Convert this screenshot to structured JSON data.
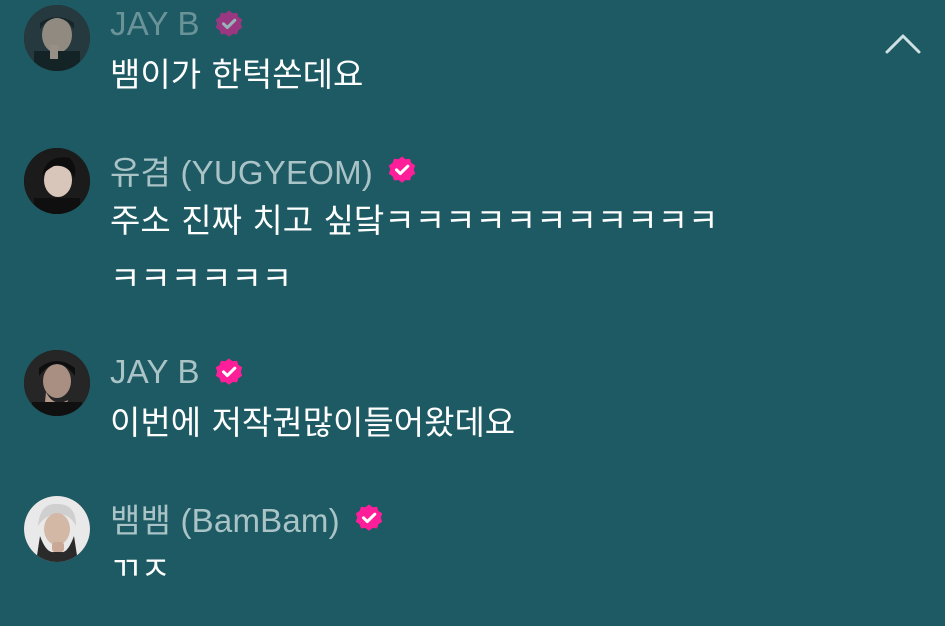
{
  "messages": [
    {
      "author": "JAY B",
      "verified": true,
      "lines": [
        "뱀이가 한턱쏜데요"
      ]
    },
    {
      "author": "유겸 (YUGYEOM)",
      "verified": true,
      "lines": [
        "주소 진짜 치고 싶닼ㅋㅋㅋㅋㅋㅋㅋㅋㅋㅋㅋ",
        "ㅋㅋㅋㅋㅋㅋ"
      ]
    },
    {
      "author": "JAY B",
      "verified": true,
      "lines": [
        "이번에 저작권많이들어왔데요"
      ]
    },
    {
      "author": "뱀뱀 (BamBam)",
      "verified": true,
      "lines": [
        "ㄲㅈ"
      ]
    }
  ],
  "colors": {
    "background": "#1d5a63",
    "name_text": "#a9c3c6",
    "message_text": "#ffffff",
    "verified_badge": "#ff1e9a"
  },
  "icons": {
    "verified": "verified-badge-icon",
    "collapse": "chevron-up-icon"
  }
}
